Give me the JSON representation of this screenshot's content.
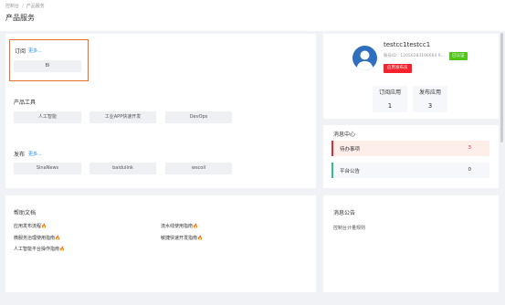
{
  "breadcrumb": {
    "home": "控制台",
    "current": "产品服务"
  },
  "page_title": "产品服务",
  "subscription": {
    "title": "订阅",
    "more": "更多...",
    "items": [
      "BI"
    ]
  },
  "tools": {
    "title": "产品工具",
    "items": [
      "人工智能",
      "工业APP快速开发",
      "DevOps"
    ]
  },
  "publish": {
    "title": "发布",
    "more": "更多...",
    "items": [
      "SinaNews",
      "baidulink",
      "wscoil"
    ]
  },
  "profile": {
    "username": "testcc1testcc1",
    "account_id": "账号ID：12050283196664 9...",
    "verified_label": "已认证",
    "apply_button": "应用发布员",
    "stats": [
      {
        "label": "订阅应用",
        "value": "1"
      },
      {
        "label": "发布应用",
        "value": "3"
      }
    ]
  },
  "messages": {
    "title": "消息中心",
    "items": [
      {
        "label": "待办事项",
        "count": "3",
        "color": "#f5222d",
        "bg": "#fdeeea"
      },
      {
        "label": "平台公告",
        "count": "0",
        "color": "#2bbf8e",
        "bg": "#f5f7fa"
      }
    ]
  },
  "help": {
    "title": "帮助文档",
    "left": [
      "应用发布流程",
      "微服务治理使用指南",
      "人工智能平台操作指南"
    ],
    "right": [
      "流水线使用指南",
      "敏捷快速开发指南"
    ],
    "hot_icon": "fire-icon"
  },
  "notice": {
    "title": "消息公告",
    "items": [
      "控制台计量规则"
    ]
  }
}
